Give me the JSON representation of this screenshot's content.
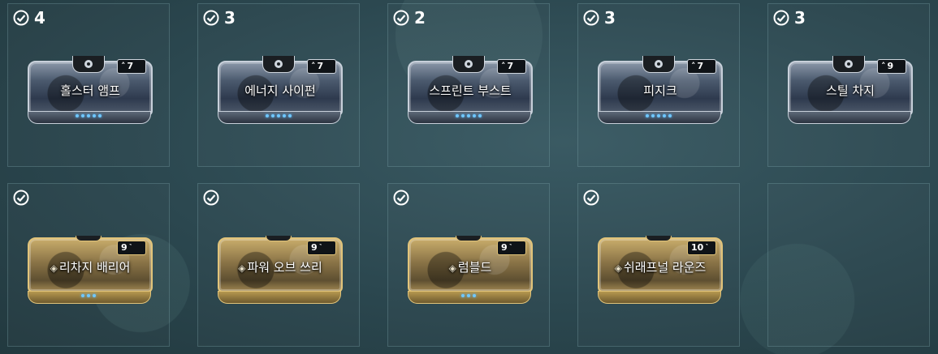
{
  "slots": [
    {
      "count": "4",
      "name": "홀스터 앰프",
      "drain": "7",
      "tier": "silver",
      "dots": 5
    },
    {
      "count": "3",
      "name": "에너지 사이펀",
      "drain": "7",
      "tier": "silver",
      "dots": 5
    },
    {
      "count": "2",
      "name": "스프린트 부스트",
      "drain": "7",
      "tier": "silver",
      "dots": 5
    },
    {
      "count": "3",
      "name": "피지크",
      "drain": "7",
      "tier": "silver",
      "dots": 5
    },
    {
      "count": "3",
      "name": "스틸 차지",
      "drain": "9",
      "tier": "silver",
      "dots": 0
    },
    {
      "count": "",
      "name": "리차지 배리어",
      "drain": "9",
      "tier": "gold",
      "dots": 3
    },
    {
      "count": "",
      "name": "파워 오브 쓰리",
      "drain": "9",
      "tier": "gold",
      "dots": 0
    },
    {
      "count": "",
      "name": "럼블드",
      "drain": "9",
      "tier": "gold",
      "dots": 3
    },
    {
      "count": "",
      "name": "쉬래프널 라운즈",
      "drain": "10",
      "tier": "gold",
      "dots": 0
    }
  ],
  "colors": {
    "background": "#2b474f",
    "silver_frame": "#c8d0da",
    "gold_frame": "#e2c47a",
    "rank_dot": "#6fc8ff"
  },
  "icons": {
    "owned": "check-circle-icon",
    "polarity": "polarity-icon",
    "drain": "drain-icon",
    "aura": "aura-diamond-icon"
  }
}
